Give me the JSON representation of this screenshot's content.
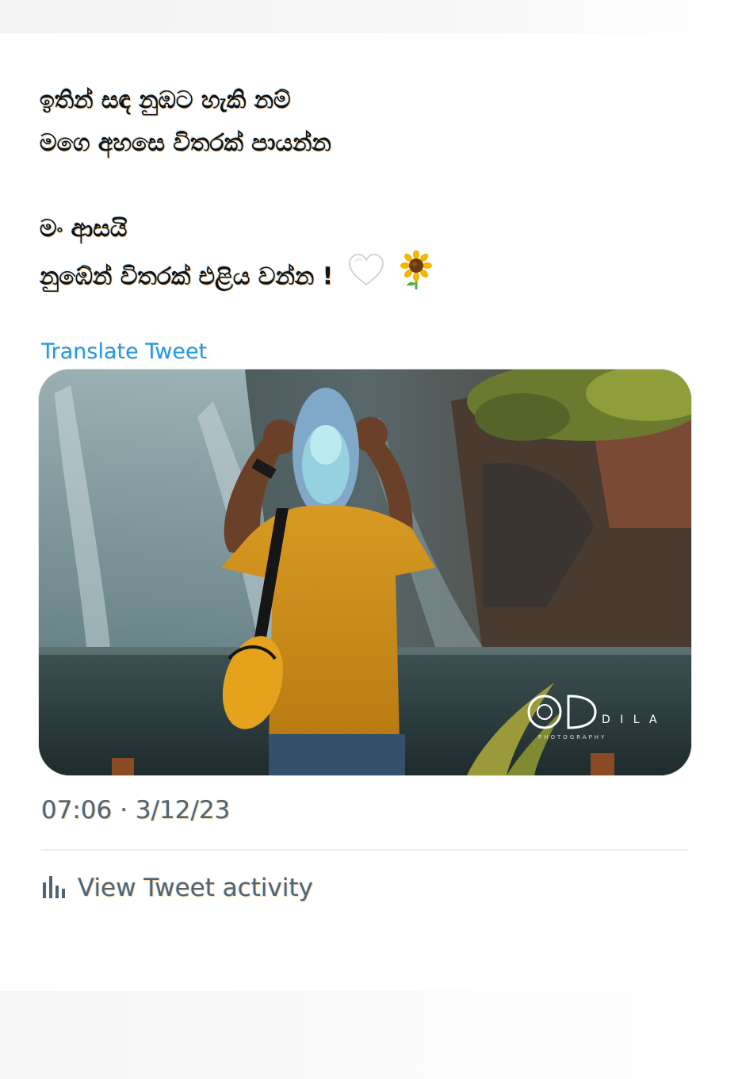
{
  "tweet": {
    "lines": [
      "ඉතින් සඳ නුඹට හැකි නම්",
      "මගෙ අහසෙ විතරක් පායන්න",
      "මං ආසයි",
      "නුඹේන් විතරක් එළිය වන්න !"
    ],
    "emojis": [
      "🤍",
      "🌻"
    ],
    "translate_label": "Translate Tweet",
    "watermark": {
      "name": "D I L A",
      "tagline": "PHOTOGRAPHY"
    },
    "timestamp": "07:06 · 3/12/23",
    "activity_label": "View Tweet activity"
  },
  "icons": {
    "activity": "bar-chart-icon",
    "heart": "white-heart-emoji",
    "flower": "sunflower-emoji"
  },
  "colors": {
    "text": "#0f1419",
    "link": "#1d9bf0",
    "secondary": "#536471",
    "divider": "#eceff1"
  }
}
